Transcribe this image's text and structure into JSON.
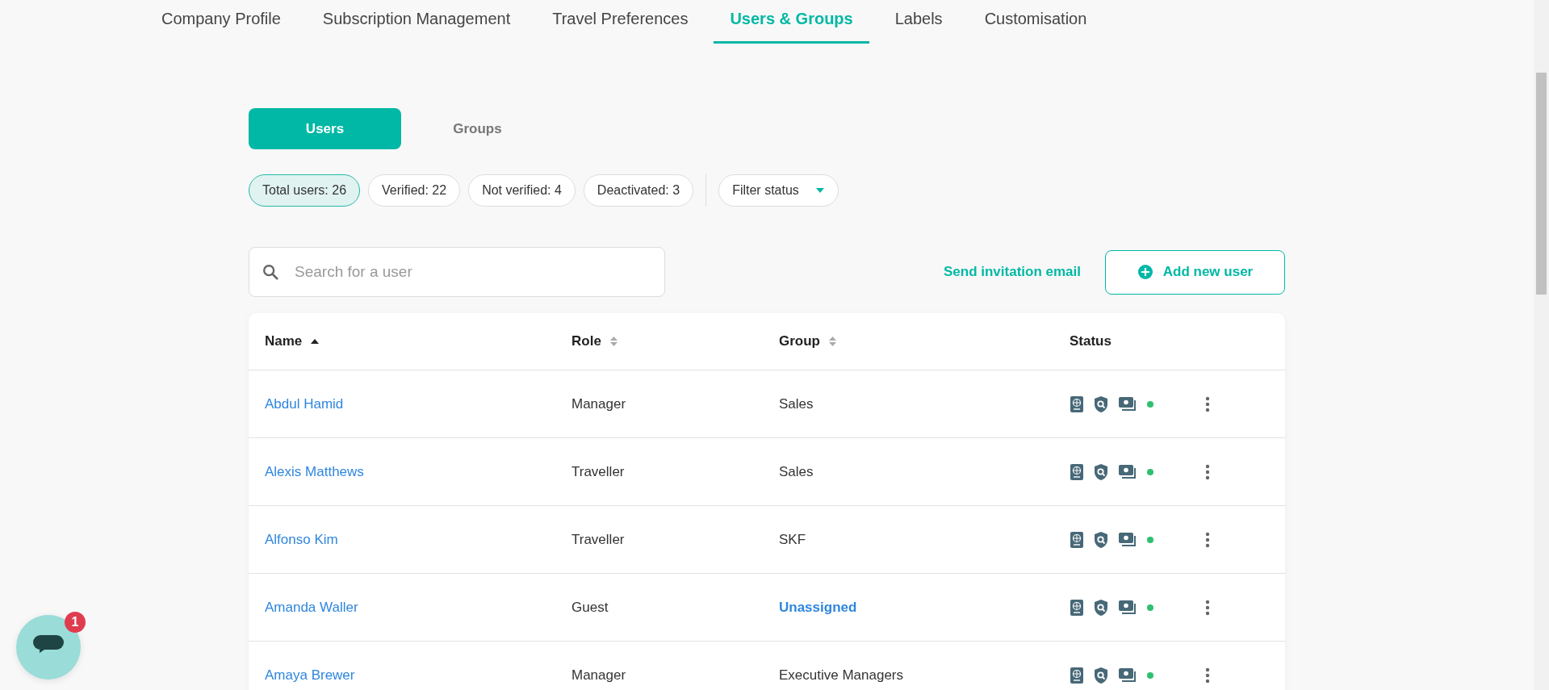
{
  "tabs": [
    {
      "label": "Company Profile",
      "selected": false
    },
    {
      "label": "Subscription Management",
      "selected": false
    },
    {
      "label": "Travel Preferences",
      "selected": false
    },
    {
      "label": "Users & Groups",
      "selected": true
    },
    {
      "label": "Labels",
      "selected": false
    },
    {
      "label": "Customisation",
      "selected": false
    }
  ],
  "toggle": [
    {
      "label": "Users",
      "selected": true
    },
    {
      "label": "Groups",
      "selected": false
    }
  ],
  "chips": [
    {
      "label": "Total users: 26",
      "selected": true
    },
    {
      "label": "Verified: 22",
      "selected": false
    },
    {
      "label": "Not verified: 4",
      "selected": false
    },
    {
      "label": "Deactivated: 3",
      "selected": false
    }
  ],
  "filter": {
    "label": "Filter status"
  },
  "search": {
    "placeholder": "Search for a user"
  },
  "send_link": "Send invitation email",
  "add_button": "Add new user",
  "table": {
    "columns": [
      {
        "label": "Name",
        "sortable": true,
        "sorted": true
      },
      {
        "label": "Role",
        "sortable": true,
        "sorted": false
      },
      {
        "label": "Group",
        "sortable": true,
        "sorted": false
      },
      {
        "label": "Status",
        "sortable": false,
        "sorted": false
      }
    ],
    "rows": [
      {
        "name": "Abdul Hamid",
        "role": "Manager",
        "group": "Sales",
        "assigned": true,
        "color": "#2fbf71"
      },
      {
        "name": "Alexis Matthews",
        "role": "Traveller",
        "group": "Sales",
        "assigned": true,
        "color": "#2fbf71"
      },
      {
        "name": "Alfonso Kim",
        "role": "Traveller",
        "group": "SKF",
        "assigned": true,
        "color": "#2fbf71"
      },
      {
        "name": "Amanda Waller",
        "role": "Guest",
        "group": "Unassigned",
        "assigned": false,
        "color": "#2fbf71"
      },
      {
        "name": "Amaya Brewer",
        "role": "Manager",
        "group": "Executive Managers",
        "assigned": true,
        "color": "#2fbf71"
      }
    ]
  },
  "chat": {
    "badge": "1"
  }
}
